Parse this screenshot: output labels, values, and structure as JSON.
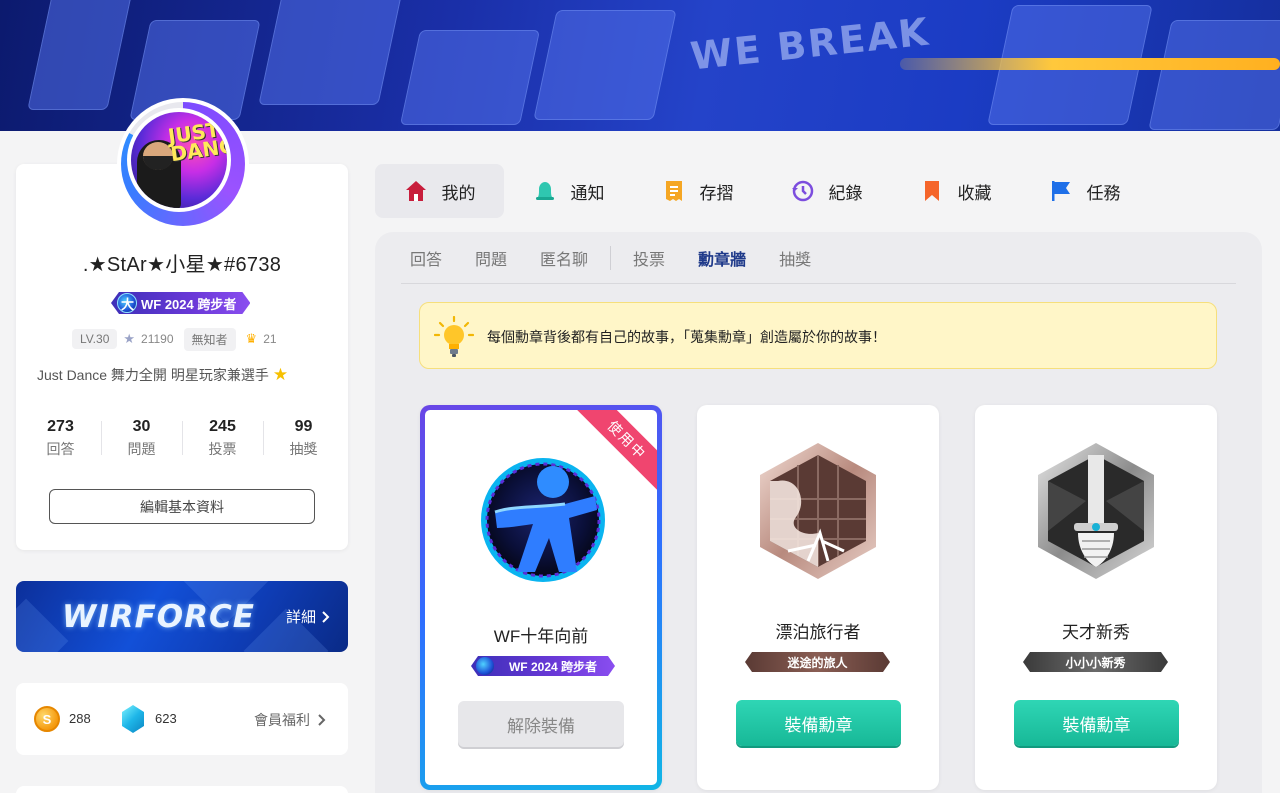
{
  "banner": {
    "words": "WE BREAK"
  },
  "profile": {
    "username": ".★StAr★小星★#6738",
    "title_badge": "WF 2024 跨步者",
    "level": "LV.30",
    "stars": "21190",
    "rank": "無知者",
    "crowns": "21",
    "bio": "Just Dance 舞力全開 明星玩家兼選手",
    "avatar_text": "JUST DANCE",
    "counts": [
      {
        "num": "273",
        "label": "回答"
      },
      {
        "num": "30",
        "label": "問題"
      },
      {
        "num": "245",
        "label": "投票"
      },
      {
        "num": "99",
        "label": "抽獎"
      }
    ],
    "edit_label": "編輯基本資料"
  },
  "wf_banner": {
    "logo": "WIRFORCE",
    "detail": "詳細"
  },
  "wallet": {
    "coins": "288",
    "gems": "623",
    "perk": "會員福利",
    "coin_symbol": "S"
  },
  "nav": [
    {
      "label": "我的",
      "icon": "home-icon",
      "color": "#c81e3c"
    },
    {
      "label": "通知",
      "icon": "bell-icon",
      "color": "#2fc7b0"
    },
    {
      "label": "存摺",
      "icon": "passbook-icon",
      "color": "#f5a623"
    },
    {
      "label": "紀錄",
      "icon": "history-icon",
      "color": "#7c4dde"
    },
    {
      "label": "收藏",
      "icon": "bookmark-icon",
      "color": "#f5652a"
    },
    {
      "label": "任務",
      "icon": "flag-icon",
      "color": "#1e6fe8"
    }
  ],
  "subtabs": [
    "回答",
    "問題",
    "匿名聊",
    "投票",
    "勳章牆",
    "抽獎"
  ],
  "tip": "每個勳章背後都有自己的故事，「蒐集勳章」創造屬於你的故事！",
  "badges": [
    {
      "name": "WF十年向前",
      "tag": "WF 2024 跨步者",
      "button": "解除裝備",
      "ribbon": "使用中",
      "equipped": true
    },
    {
      "name": "漂泊旅行者",
      "tag": "迷途的旅人",
      "button": "裝備勳章",
      "equipped": false
    },
    {
      "name": "天才新秀",
      "tag": "小小小新秀",
      "button": "裝備勳章",
      "equipped": false
    }
  ],
  "colors": {
    "accent": "#1f3a8a",
    "equip": "#17b897",
    "ribbon": "#f0456f"
  }
}
